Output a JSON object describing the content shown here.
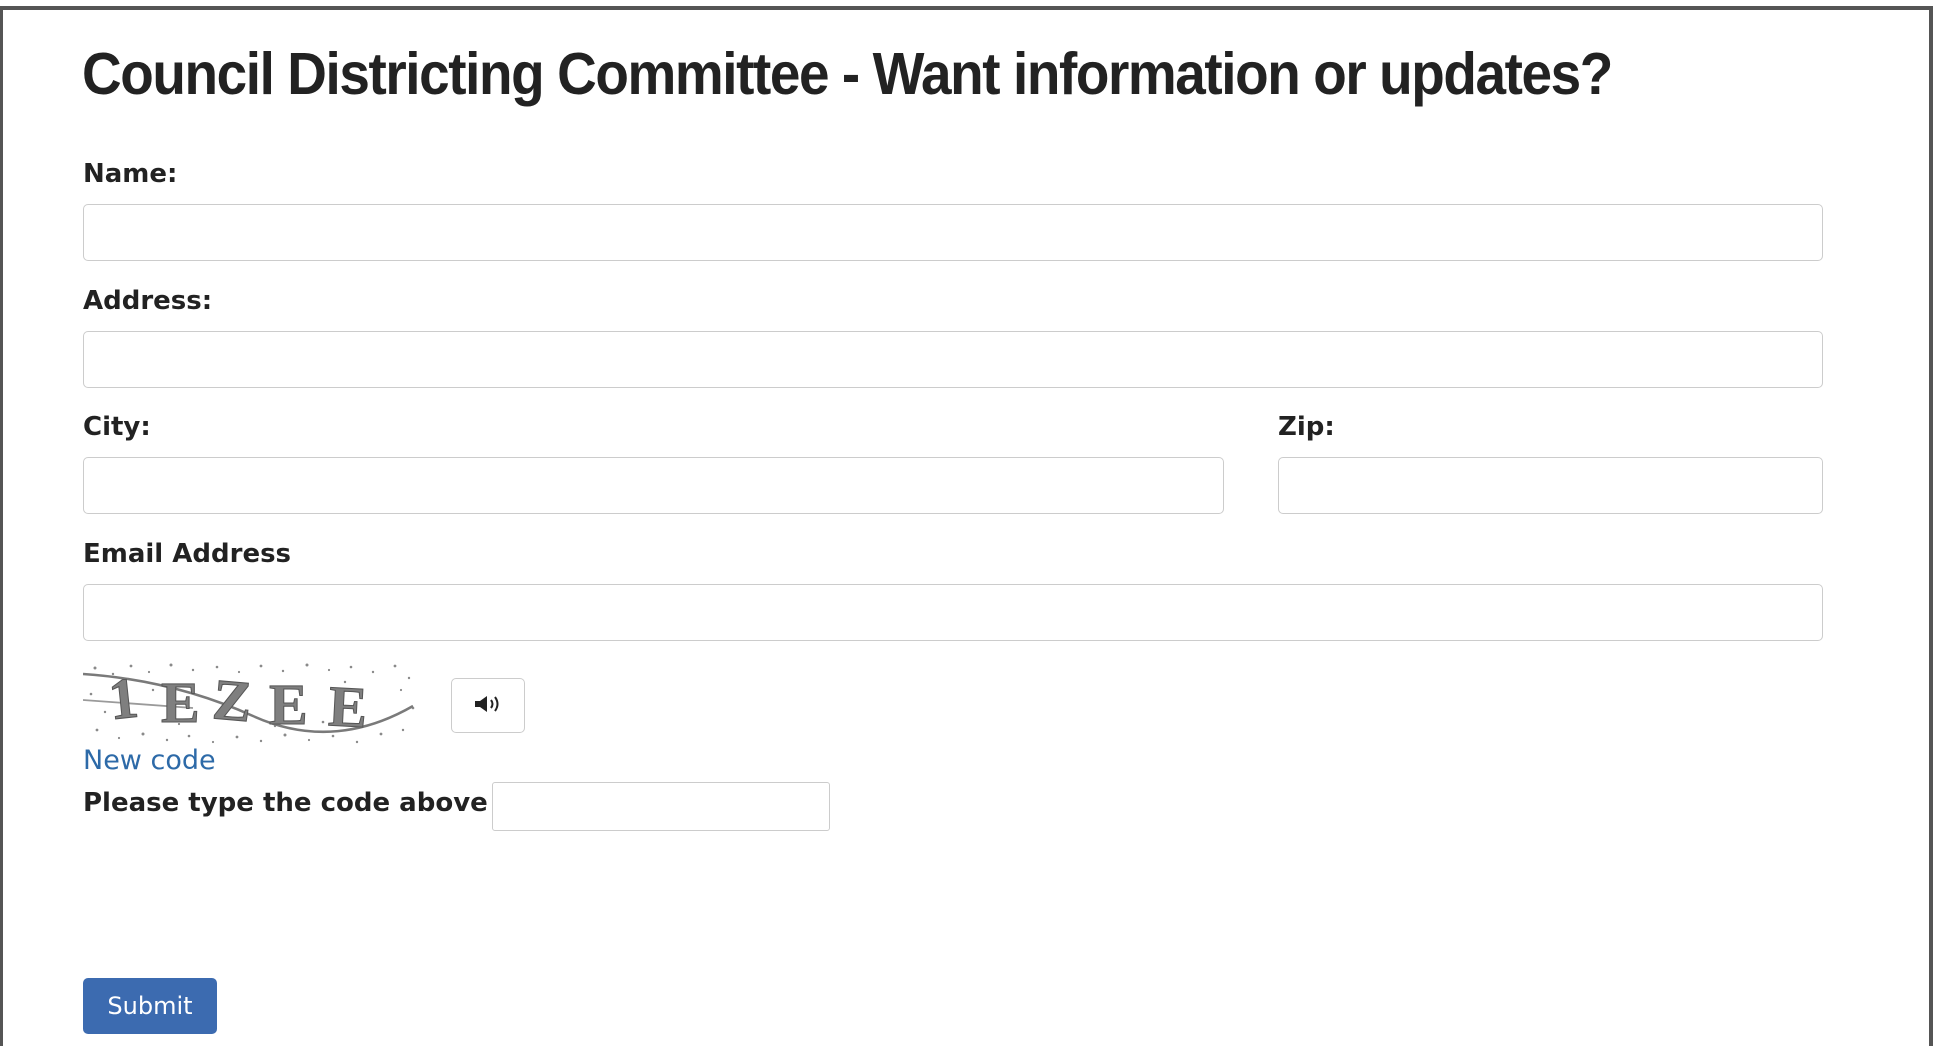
{
  "form": {
    "title": "Council Districting Committee - Want information or updates?",
    "name_label": "Name:",
    "name_value": "",
    "address_label": "Address:",
    "address_value": "",
    "city_label": "City:",
    "city_value": "",
    "zip_label": "Zip:",
    "zip_value": "",
    "email_label": "Email Address",
    "email_value": "",
    "captcha": {
      "image_text": "1EZEE",
      "audio_icon": "speaker-icon",
      "new_code_label": "New code",
      "prompt_label": "Please type the code above",
      "code_value": ""
    },
    "submit_label": "Submit"
  },
  "colors": {
    "link": "#2d6aa8",
    "submit_bg": "#3c6bb0",
    "text": "#222222",
    "field_border": "#cccccc"
  }
}
